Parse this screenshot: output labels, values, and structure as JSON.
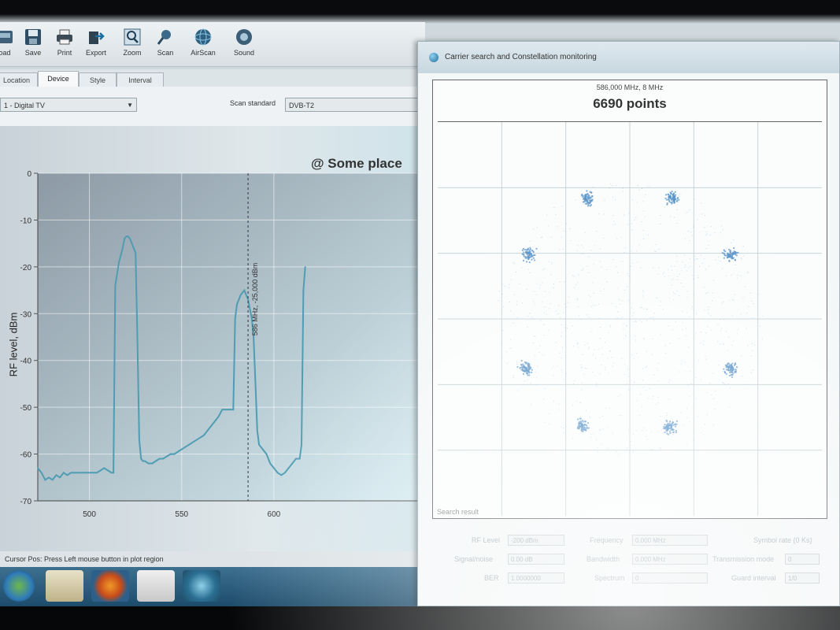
{
  "toolbar": {
    "buttons": [
      {
        "label": "oad",
        "icon": "load-icon"
      },
      {
        "label": "Save",
        "icon": "save-icon"
      },
      {
        "label": "Print",
        "icon": "print-icon"
      },
      {
        "label": "Export",
        "icon": "export-icon"
      },
      {
        "label": "Zoom",
        "icon": "zoom-icon"
      },
      {
        "label": "Scan",
        "icon": "scan-icon"
      },
      {
        "label": "AirScan",
        "icon": "airscan-icon"
      },
      {
        "label": "Sound",
        "icon": "sound-icon"
      }
    ]
  },
  "tabs": [
    "Location",
    "Device",
    "Style",
    "Interval"
  ],
  "active_tab": "Device",
  "device_select": {
    "value": "1 - Digital TV"
  },
  "scan": {
    "label": "Scan standard",
    "value": "DVB-T2"
  },
  "plot": {
    "title": "@ Some place"
  },
  "status": {
    "text": "Cursor Pos: Press Left mouse button in plot region"
  },
  "dialog": {
    "title": "Carrier search and Constellation monitoring",
    "freq_info": "586,000 MHz, 8 MHz",
    "points": "6690 points",
    "search_result": "Search result",
    "fields": {
      "rf_level": {
        "label": "RF Level",
        "value": "-200 dBm"
      },
      "signal_noise": {
        "label": "Signal/noise",
        "value": "0.00 dB"
      },
      "ber": {
        "label": "BER",
        "value": "1.0000000"
      },
      "frequency": {
        "label": "Frequency",
        "value": "0.000 MHz"
      },
      "bandwidth": {
        "label": "Bandwidth",
        "value": "0.000 MHz"
      },
      "spectrum": {
        "label": "Spectrum",
        "value": "0"
      },
      "symbol_rate": {
        "label": "Symbol rate (0 Ks)"
      },
      "transmission_mode": {
        "label": "Transmission mode",
        "value": "0"
      },
      "guard_interval": {
        "label": "Guard interval",
        "value": "1/0"
      }
    }
  },
  "colors": {
    "trace": "#4f9db3",
    "plot_bg_left": "#8d9aa5",
    "plot_bg_right": "#d6ecf2",
    "constellation": "#5a94c8"
  },
  "chart_data": [
    {
      "type": "line",
      "title": "@ Some place",
      "xlabel": "",
      "ylabel": "RF level, dBm",
      "xlim": [
        472,
        682
      ],
      "ylim": [
        -70,
        0
      ],
      "xticks": [
        500,
        550,
        600
      ],
      "yticks": [
        0,
        -10,
        -20,
        -30,
        -40,
        -50,
        -60,
        -70
      ],
      "grid": true,
      "cursor": {
        "x": 586,
        "label": "586 MHz, -25,000 dBm"
      },
      "series": [
        {
          "x": [
            472,
            474,
            476,
            478,
            480,
            482,
            484,
            486,
            488,
            490,
            492,
            494,
            496,
            498,
            500,
            502,
            504,
            506,
            508,
            510,
            512,
            513,
            514,
            516,
            518,
            519,
            520,
            521,
            522,
            523,
            524,
            525,
            526,
            527,
            528,
            529,
            530,
            532,
            534,
            536,
            538,
            540,
            542,
            544,
            546,
            548,
            550,
            552,
            554,
            556,
            558,
            560,
            562,
            564,
            566,
            568,
            570,
            572,
            574,
            576,
            578,
            579,
            580,
            581,
            582,
            583,
            584,
            585,
            586,
            587,
            588,
            589,
            590,
            591,
            592,
            594,
            596,
            598,
            600,
            602,
            604,
            606,
            608,
            610,
            612,
            614,
            615,
            616,
            617
          ],
          "y": [
            -63,
            -64,
            -65.5,
            -65,
            -65.5,
            -64.5,
            -65,
            -64,
            -64.5,
            -64,
            -64,
            -64,
            -64,
            -64,
            -64,
            -64,
            -64,
            -63.5,
            -63,
            -63.5,
            -64,
            -64,
            -24,
            -19,
            -16,
            -14,
            -13.5,
            -13.5,
            -14,
            -15,
            -16,
            -17,
            -35,
            -57,
            -61,
            -61.5,
            -61.5,
            -62,
            -62,
            -61.5,
            -61,
            -61,
            -60.5,
            -60,
            -60,
            -59.5,
            -59,
            -58.5,
            -58,
            -57.5,
            -57,
            -56.5,
            -56,
            -55,
            -54,
            -53,
            -52,
            -50.5,
            -50.5,
            -50.5,
            -50.5,
            -31,
            -28,
            -27,
            -26,
            -25.5,
            -25,
            -26,
            -27,
            -29,
            -31,
            -35,
            -45,
            -55,
            -58,
            -59,
            -60,
            -62,
            -63,
            -64,
            -64.5,
            -64,
            -63,
            -62,
            -61,
            -61,
            -58,
            -25,
            -20
          ]
        }
      ]
    },
    {
      "type": "scatter",
      "title": "6690 points",
      "subtitle": "586,000 MHz, 8 MHz",
      "xlim": [
        -1.5,
        1.5
      ],
      "ylim": [
        -1.5,
        1.5
      ],
      "grid": true,
      "clusters": [
        {
          "x": -0.33,
          "y": 0.92
        },
        {
          "x": 0.33,
          "y": 0.92
        },
        {
          "x": -0.79,
          "y": 0.49
        },
        {
          "x": 0.79,
          "y": 0.49
        },
        {
          "x": -0.81,
          "y": -0.38
        },
        {
          "x": 0.79,
          "y": -0.38
        },
        {
          "x": -0.37,
          "y": -0.81
        },
        {
          "x": 0.31,
          "y": -0.82
        }
      ]
    }
  ]
}
